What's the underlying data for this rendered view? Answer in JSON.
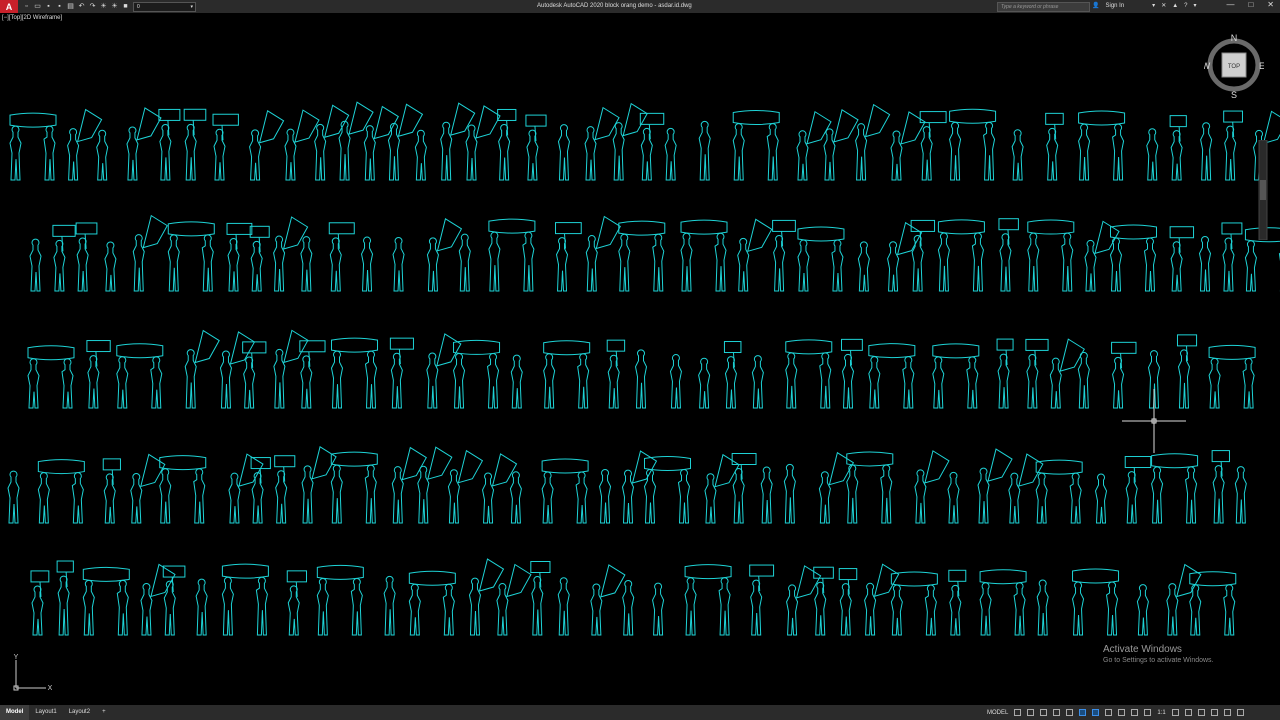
{
  "titlebar": {
    "logo": "A",
    "layer_value": "0",
    "title": "Autodesk AutoCAD 2020   block orang demo - asdar.id.dwg",
    "search_placeholder": "Type a keyword or phrase",
    "sign_in": "Sign In",
    "help": "?",
    "min": "—",
    "max": "□",
    "close": "✕"
  },
  "viewport": {
    "label": "[−][Top][2D Wireframe]"
  },
  "viewcube": {
    "top": "TOP",
    "north": "N",
    "south": "S",
    "east": "E",
    "west": "W"
  },
  "ucs": {
    "y": "Y",
    "x": "X"
  },
  "watermark": {
    "line1": "Activate Windows",
    "line2": "Go to Settings to activate Windows."
  },
  "statusbar": {
    "tabs": [
      "Model",
      "Layout1",
      "Layout2"
    ],
    "add_tab": "+",
    "model_label": "MODEL",
    "scale": "1:1"
  },
  "colors": {
    "linework": "#1ed3d6",
    "background": "#000000",
    "chrome": "#2b2b2b"
  }
}
